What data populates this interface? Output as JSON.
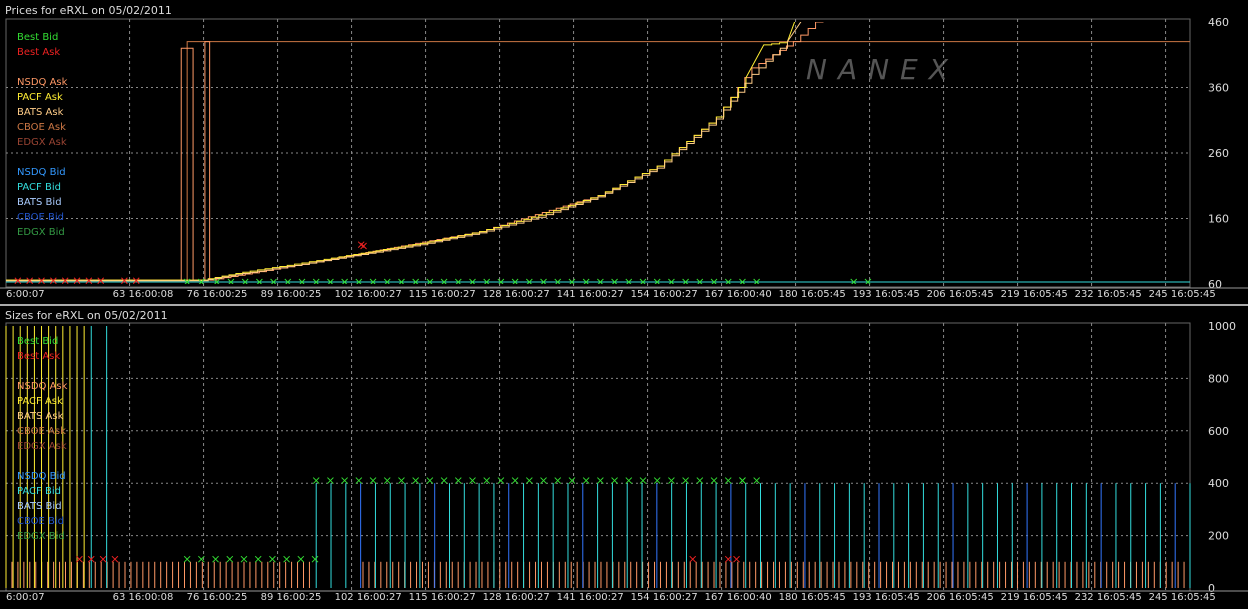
{
  "chart_data": [
    {
      "type": "line",
      "title": "Prices for  eRXL  on  05/02/2011",
      "ylim": [
        60,
        460
      ],
      "yticks": [
        60,
        160,
        260,
        360,
        460
      ],
      "xtick_labels": [
        "6:00:07",
        "63 16:00:08",
        "76 16:00:25",
        "89 16:00:25",
        "102 16:00:27",
        "115 16:00:27",
        "128 16:00:27",
        "141 16:00:27",
        "154 16:00:27",
        "167 16:00:40",
        "180 16:05:45",
        "193 16:05:45",
        "206 16:05:45",
        "219 16:05:45",
        "232 16:05:45",
        "245 16:05:45"
      ],
      "grid": true,
      "watermark": "NANEX",
      "legend": [
        {
          "label": "Best Bid",
          "color": "#33dd33"
        },
        {
          "label": "Best Ask",
          "color": "#ee2222"
        },
        {
          "label": "NSDQ Ask",
          "color": "#ff9966"
        },
        {
          "label": "PACF Ask",
          "color": "#ffee33"
        },
        {
          "label": "BATS Ask",
          "color": "#ffcc88"
        },
        {
          "label": "CBOE Ask",
          "color": "#cc7744"
        },
        {
          "label": "EDGX Ask",
          "color": "#994433"
        },
        {
          "label": "NSDQ Bid",
          "color": "#3399ff"
        },
        {
          "label": "PACF Bid",
          "color": "#33dddd"
        },
        {
          "label": "BATS Bid",
          "color": "#aaccff"
        },
        {
          "label": "CBOE Bid",
          "color": "#2255cc"
        },
        {
          "label": "EDGX Bid",
          "color": "#339944"
        }
      ],
      "series": [
        {
          "name": "CBOE Ask",
          "color": "#cc7744",
          "points": [
            [
              0,
              65
            ],
            [
              0.153,
              65
            ],
            [
              0.153,
              430
            ],
            [
              1,
              430
            ]
          ]
        },
        {
          "name": "NSDQ Ask",
          "color": "#ff9966",
          "points": [
            [
              0,
              66
            ],
            [
              0.148,
              66
            ],
            [
              0.148,
              420
            ],
            [
              0.158,
              420
            ],
            [
              0.158,
              66
            ],
            [
              0.168,
              66
            ],
            [
              0.168,
              430
            ],
            [
              0.172,
              430
            ],
            [
              0.172,
              66
            ],
            [
              0.25,
              90
            ],
            [
              0.4,
              140
            ],
            [
              0.5,
              195
            ],
            [
              0.55,
              240
            ],
            [
              0.6,
              315
            ],
            [
              0.63,
              390
            ],
            [
              0.665,
              430
            ],
            [
              0.69,
              470
            ]
          ]
        },
        {
          "name": "PACF Ask",
          "color": "#ffee33",
          "points": [
            [
              0,
              66
            ],
            [
              0.165,
              66
            ],
            [
              0.2,
              78
            ],
            [
              0.25,
              92
            ],
            [
              0.3,
              107
            ],
            [
              0.35,
              122
            ],
            [
              0.4,
              140
            ],
            [
              0.45,
              165
            ],
            [
              0.5,
              195
            ],
            [
              0.55,
              240
            ],
            [
              0.6,
              315
            ],
            [
              0.625,
              375
            ],
            [
              0.64,
              425
            ],
            [
              0.66,
              430
            ],
            [
              0.668,
              470
            ]
          ]
        },
        {
          "name": "BATS Ask",
          "color": "#ffcc88",
          "points": [
            [
              0,
              65
            ],
            [
              0.165,
              65
            ],
            [
              0.2,
              76
            ],
            [
              0.25,
              90
            ],
            [
              0.3,
              105
            ],
            [
              0.35,
              120
            ],
            [
              0.4,
              138
            ],
            [
              0.45,
              162
            ],
            [
              0.5,
              193
            ],
            [
              0.55,
              237
            ],
            [
              0.6,
              312
            ],
            [
              0.63,
              380
            ],
            [
              0.66,
              430
            ],
            [
              0.675,
              470
            ]
          ]
        },
        {
          "name": "PACF Bid",
          "color": "#33dddd",
          "points": [
            [
              0,
              63
            ],
            [
              1,
              63
            ]
          ]
        },
        {
          "name": "Best Ask",
          "color": "#ee2222",
          "marker": "x",
          "points": [
            [
              0.01,
              65
            ],
            [
              0.02,
              65
            ],
            [
              0.03,
              65
            ],
            [
              0.04,
              65
            ],
            [
              0.05,
              65
            ],
            [
              0.06,
              65
            ],
            [
              0.07,
              65
            ],
            [
              0.08,
              65
            ],
            [
              0.1,
              65
            ],
            [
              0.11,
              65
            ],
            [
              0.3,
              120
            ],
            [
              0.302,
              118
            ]
          ]
        },
        {
          "name": "Best Bid",
          "color": "#33dd33",
          "marker": "x",
          "points": [
            [
              0.153,
              63
            ],
            [
              0.165,
              63
            ],
            [
              0.178,
              63
            ],
            [
              0.19,
              63
            ],
            [
              0.202,
              63
            ],
            [
              0.214,
              63
            ],
            [
              0.226,
              63
            ],
            [
              0.238,
              63
            ],
            [
              0.25,
              63
            ],
            [
              0.262,
              63
            ],
            [
              0.274,
              63
            ],
            [
              0.286,
              63
            ],
            [
              0.298,
              63
            ],
            [
              0.31,
              63
            ],
            [
              0.322,
              63
            ],
            [
              0.334,
              63
            ],
            [
              0.346,
              63
            ],
            [
              0.358,
              63
            ],
            [
              0.37,
              63
            ],
            [
              0.382,
              63
            ],
            [
              0.394,
              63
            ],
            [
              0.406,
              63
            ],
            [
              0.418,
              63
            ],
            [
              0.43,
              63
            ],
            [
              0.442,
              63
            ],
            [
              0.454,
              63
            ],
            [
              0.466,
              63
            ],
            [
              0.478,
              63
            ],
            [
              0.49,
              63
            ],
            [
              0.502,
              63
            ],
            [
              0.514,
              63
            ],
            [
              0.526,
              63
            ],
            [
              0.538,
              63
            ],
            [
              0.55,
              63
            ],
            [
              0.562,
              63
            ],
            [
              0.574,
              63
            ],
            [
              0.586,
              63
            ],
            [
              0.598,
              63
            ],
            [
              0.61,
              63
            ],
            [
              0.622,
              63
            ],
            [
              0.634,
              63
            ],
            [
              0.716,
              63
            ],
            [
              0.728,
              63
            ]
          ]
        }
      ]
    },
    {
      "type": "bar",
      "title": "Sizes for  eRXL  on  05/02/2011",
      "ylim": [
        0,
        1000
      ],
      "yticks": [
        0,
        200,
        400,
        600,
        800,
        1000
      ],
      "xtick_labels": [
        "6:00:07",
        "63 16:00:08",
        "76 16:00:25",
        "89 16:00:25",
        "102 16:00:27",
        "115 16:00:27",
        "128 16:00:27",
        "141 16:00:27",
        "154 16:00:27",
        "167 16:00:40",
        "180 16:05:45",
        "193 16:05:45",
        "206 16:05:45",
        "219 16:05:45",
        "232 16:05:45",
        "245 16:05:45"
      ],
      "grid": true,
      "legend": [
        {
          "label": "Best Bid",
          "color": "#33dd33"
        },
        {
          "label": "Best Ask",
          "color": "#ee2222"
        },
        {
          "label": "NSDQ Ask",
          "color": "#ff9966"
        },
        {
          "label": "PACF Ask",
          "color": "#ffee33"
        },
        {
          "label": "BATS Ask",
          "color": "#ffcc88"
        },
        {
          "label": "CBOE Ask",
          "color": "#cc7744"
        },
        {
          "label": "EDGX Ask",
          "color": "#994433"
        },
        {
          "label": "NSDQ Bid",
          "color": "#3399ff"
        },
        {
          "label": "PACF Bid",
          "color": "#33dddd"
        },
        {
          "label": "BATS Bid",
          "color": "#aaccff"
        },
        {
          "label": "CBOE Bid",
          "color": "#2255cc"
        },
        {
          "label": "EDGX Bid",
          "color": "#339944"
        }
      ],
      "ask_spikes": {
        "color": "#ff9966",
        "value": 100,
        "count": 200
      },
      "yellow_spikes": {
        "color": "#ffee33",
        "x": [
          0.0,
          0.006,
          0.012,
          0.018,
          0.024,
          0.03,
          0.036,
          0.042,
          0.048,
          0.054,
          0.06,
          0.066
        ],
        "value": 1000
      },
      "cyan_spikes": {
        "color": "#33dddd",
        "value": 400,
        "x_start": 0.262,
        "x_end": 1.0,
        "count": 60
      },
      "early_cyan": {
        "color": "#33dddd",
        "x": [
          0.072,
          0.085
        ],
        "value": 1000
      },
      "best_bid_x_low": {
        "color": "#33dd33",
        "value": 110,
        "x": [
          0.153,
          0.165,
          0.177,
          0.189,
          0.201,
          0.213,
          0.225,
          0.237,
          0.249,
          0.261
        ]
      },
      "best_bid_x_high": {
        "color": "#33dd33",
        "value": 410,
        "x": [
          0.262,
          0.274,
          0.286,
          0.298,
          0.31,
          0.322,
          0.334,
          0.346,
          0.358,
          0.37,
          0.382,
          0.394,
          0.406,
          0.418,
          0.43,
          0.442,
          0.454,
          0.466,
          0.478,
          0.49,
          0.502,
          0.514,
          0.526,
          0.538,
          0.55,
          0.562,
          0.574,
          0.586,
          0.598,
          0.61,
          0.622,
          0.634,
          0.622
        ]
      },
      "best_ask_x": {
        "color": "#ee2222",
        "value": 110,
        "x": [
          0.062,
          0.072,
          0.082,
          0.092,
          0.58,
          0.61,
          0.617
        ]
      }
    }
  ]
}
